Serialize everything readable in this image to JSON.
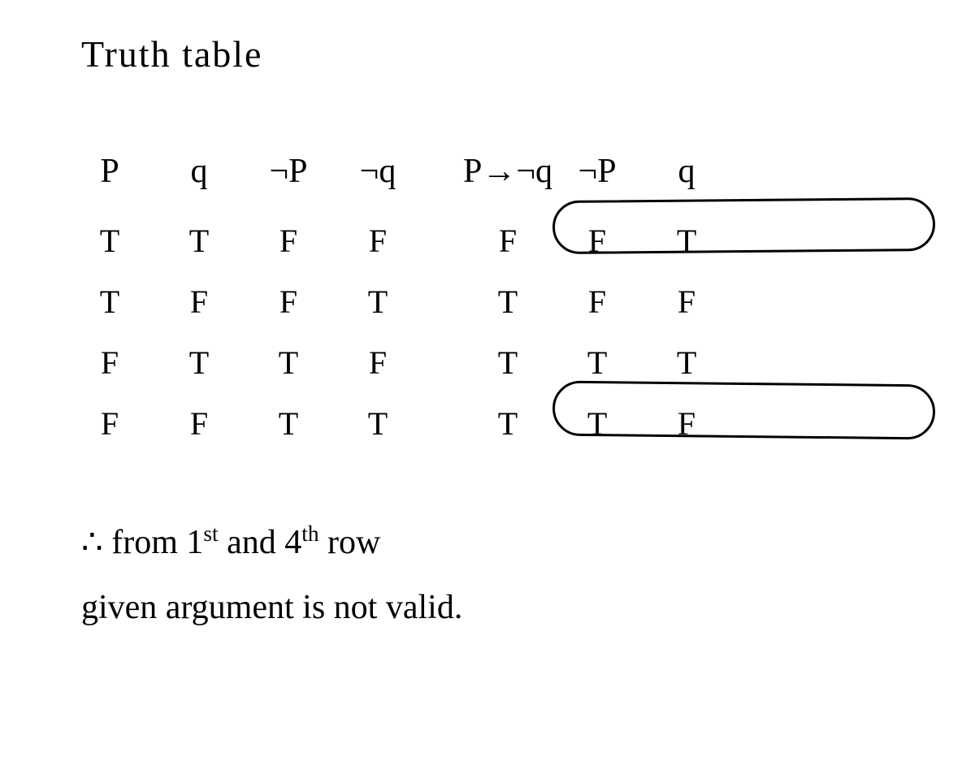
{
  "title": "Truth table",
  "headers": {
    "p": "P",
    "q": "q",
    "notp": "¬P",
    "notq": "¬q",
    "pimpnotq": "P→¬q",
    "notp2": "¬P",
    "q2": "q"
  },
  "rows": [
    {
      "p": "T",
      "q": "T",
      "notp": "F",
      "notq": "F",
      "pimpnotq": "F",
      "notp2": "F",
      "q2": "T"
    },
    {
      "p": "T",
      "q": "F",
      "notp": "F",
      "notq": "T",
      "pimpnotq": "T",
      "notp2": "F",
      "q2": "F"
    },
    {
      "p": "F",
      "q": "T",
      "notp": "T",
      "notq": "F",
      "pimpnotq": "T",
      "notp2": "T",
      "q2": "T"
    },
    {
      "p": "F",
      "q": "F",
      "notp": "T",
      "notq": "T",
      "pimpnotq": "T",
      "notp2": "T",
      "q2": "F"
    }
  ],
  "conclusion": {
    "prefix": "∴ from 1",
    "sup1": "st",
    "mid": " and 4",
    "sup2": "th",
    "after": " row",
    "line2": "given argument is not valid."
  },
  "chart_data": {
    "type": "table",
    "title": "Truth table",
    "columns": [
      "P",
      "q",
      "¬P",
      "¬q",
      "P→¬q",
      "¬P",
      "q"
    ],
    "rows": [
      [
        "T",
        "T",
        "F",
        "F",
        "F",
        "F",
        "T"
      ],
      [
        "T",
        "F",
        "F",
        "T",
        "T",
        "F",
        "F"
      ],
      [
        "F",
        "T",
        "T",
        "F",
        "T",
        "T",
        "T"
      ],
      [
        "F",
        "F",
        "T",
        "T",
        "T",
        "T",
        "F"
      ]
    ],
    "highlighted_rows": [
      0,
      3
    ],
    "conclusion": "∴ from 1st and 4th row given argument is not valid."
  }
}
